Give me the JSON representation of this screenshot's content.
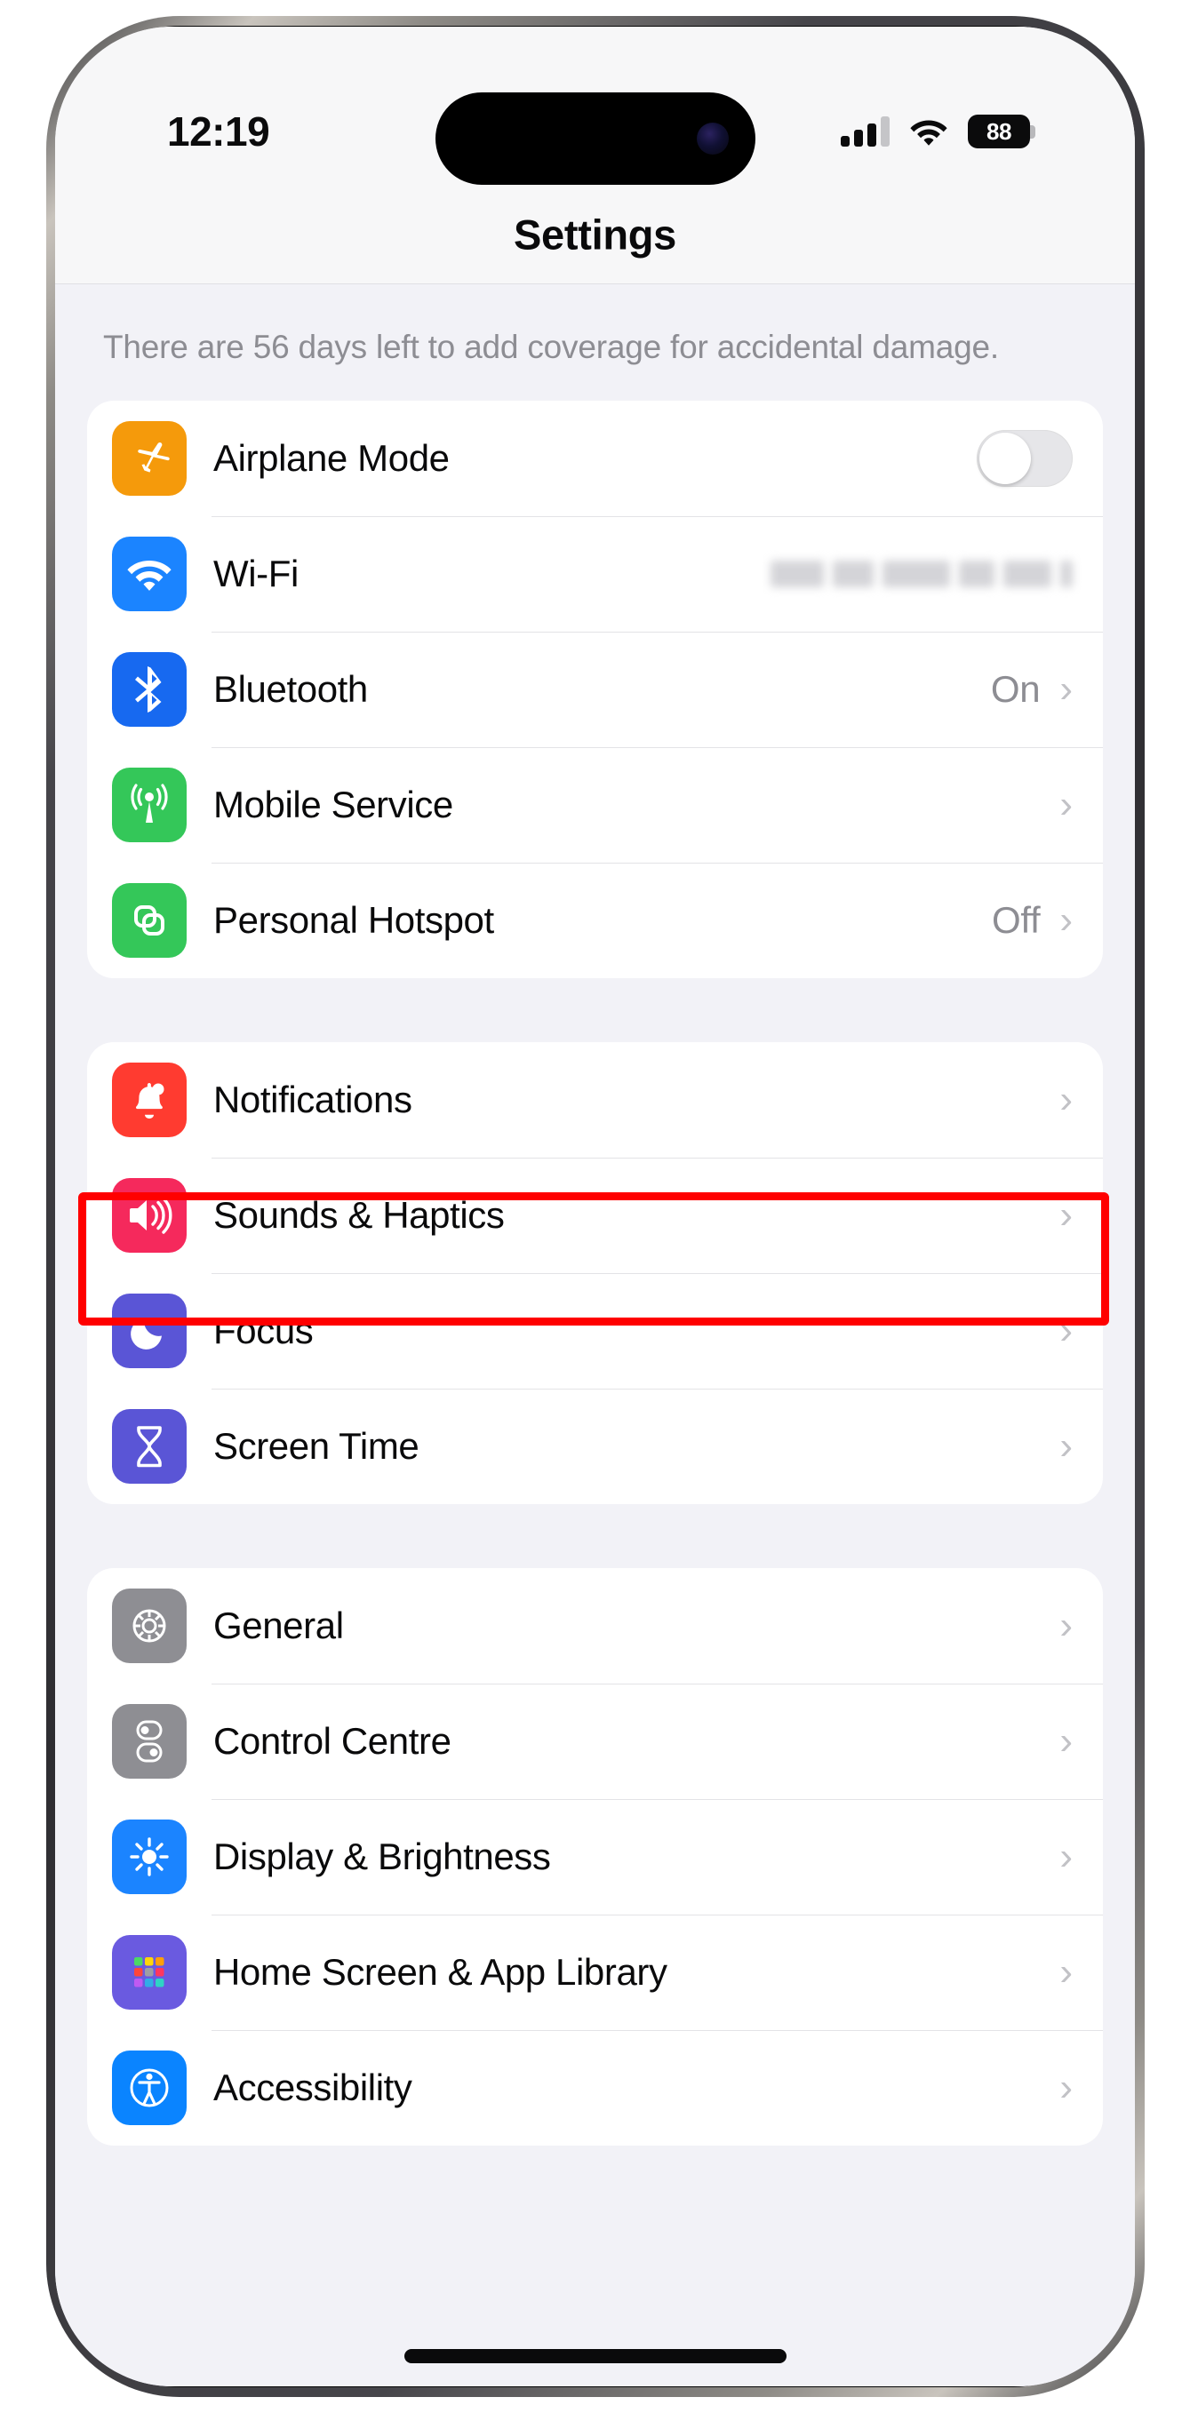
{
  "status_bar": {
    "time": "12:19",
    "signal_icon": "cellular-signal-icon",
    "signal_bars_filled": 3,
    "signal_bars_total": 4,
    "wifi_icon": "wifi-icon",
    "battery_icon": "battery-icon",
    "battery_level": "88"
  },
  "nav": {
    "title": "Settings"
  },
  "content": {
    "warranty_note": "There are 56 days left to add coverage for accidental damage."
  },
  "groups": [
    {
      "id": "connectivity",
      "rows": [
        {
          "label": "Airplane Mode",
          "icon": "airplane-icon",
          "icon_color": "#f59a0b",
          "control": "toggle",
          "toggle_on": false
        },
        {
          "label": "Wi-Fi",
          "icon": "wifi-icon",
          "icon_color": "#1b84ff",
          "control": "blurred-value"
        },
        {
          "label": "Bluetooth",
          "icon": "bluetooth-icon",
          "icon_color": "#1769f0",
          "control": "value-chevron",
          "value": "On"
        },
        {
          "label": "Mobile Service",
          "icon": "antenna-icon",
          "icon_color": "#34c759",
          "control": "chevron"
        },
        {
          "label": "Personal Hotspot",
          "icon": "hotspot-link-icon",
          "icon_color": "#34c759",
          "control": "value-chevron",
          "value": "Off"
        }
      ]
    },
    {
      "id": "alerts",
      "rows": [
        {
          "label": "Notifications",
          "icon": "bell-icon",
          "icon_color": "#ff3b30",
          "control": "chevron",
          "highlighted": true
        },
        {
          "label": "Sounds & Haptics",
          "icon": "speaker-waves-icon",
          "icon_color": "#f5295c",
          "control": "chevron"
        },
        {
          "label": "Focus",
          "icon": "moon-icon",
          "icon_color": "#5a55d6",
          "control": "chevron"
        },
        {
          "label": "Screen Time",
          "icon": "hourglass-icon",
          "icon_color": "#5a55d6",
          "control": "chevron"
        }
      ]
    },
    {
      "id": "system",
      "rows": [
        {
          "label": "General",
          "icon": "gear-icon",
          "icon_color": "#8e8e93",
          "control": "chevron"
        },
        {
          "label": "Control Centre",
          "icon": "sliders-icon",
          "icon_color": "#8e8e93",
          "control": "chevron"
        },
        {
          "label": "Display & Brightness",
          "icon": "brightness-sun-icon",
          "icon_color": "#1b84ff",
          "control": "chevron"
        },
        {
          "label": "Home Screen & App Library",
          "icon": "app-grid-icon",
          "icon_color": "#6a5ae0",
          "control": "chevron"
        },
        {
          "label": "Accessibility",
          "icon": "accessibility-icon",
          "icon_color": "#0a84ff",
          "control": "chevron"
        }
      ]
    }
  ],
  "annotation": {
    "highlight_color": "#ff0000",
    "highlight_target": "Notifications"
  },
  "icons": {
    "chevron_glyph": "›"
  }
}
